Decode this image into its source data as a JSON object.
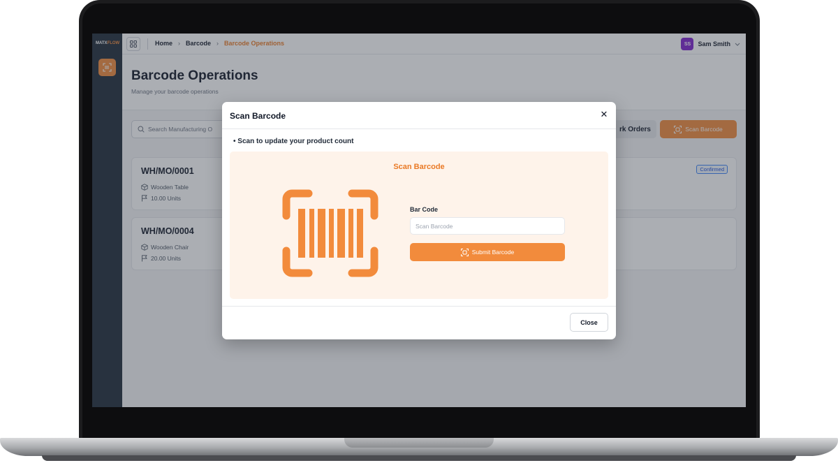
{
  "app": {
    "logo_prefix": "MATX",
    "logo_suffix": "FLOW"
  },
  "breadcrumb": {
    "items": [
      "Home",
      "Barcode",
      "Barcode Operations"
    ]
  },
  "user": {
    "initials": "SS",
    "name": "Sam Smith"
  },
  "header": {
    "title": "Barcode Operations",
    "subtitle": "Manage your barcode operations"
  },
  "toolbar": {
    "search_placeholder": "Search Manufacturing O",
    "work_orders_label": "rk Orders",
    "scan_label": "Scan Barcode"
  },
  "orders": [
    {
      "code": "WH/MO/0001",
      "product": "Wooden Table",
      "quantity": "10.00 Units",
      "status": "Confirmed"
    },
    {
      "code": "WH/MO/0004",
      "product": "Wooden Chair",
      "quantity": "20.00 Units",
      "status": ""
    }
  ],
  "modal": {
    "title": "Scan Barcode",
    "instruction": "Scan to update your product count",
    "panel_title": "Scan Barcode",
    "field_label": "Bar Code",
    "field_placeholder": "Scan Barcode",
    "submit_label": "Submit Barcode",
    "close_label": "Close"
  },
  "colors": {
    "accent": "#f28b3c",
    "sidebar": "#1e2a38",
    "badge": "#3b82f6"
  }
}
